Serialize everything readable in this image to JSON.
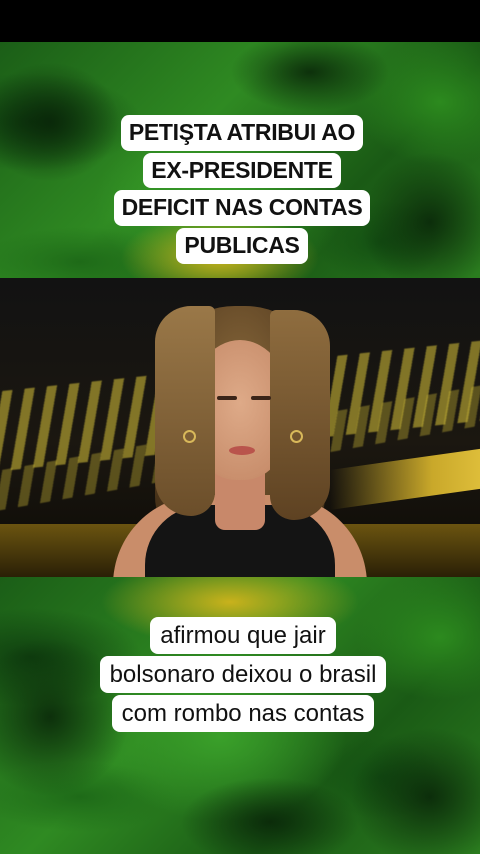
{
  "overlay_top": {
    "lines": [
      "PETIŞTA ATRIBUI AO",
      "EX-PRESIDENTE",
      "DEFICIT NAS CONTAS",
      "PUBLICAS"
    ]
  },
  "overlay_bottom": {
    "lines": [
      "afirmou que jair",
      "bolsonaro deixou o brasil",
      "com rombo nas contas"
    ]
  },
  "colors": {
    "background_green": "#2f8a22",
    "accent_yellow": "#c9b21c",
    "caption_bg": "#ffffff",
    "caption_text": "#111111"
  }
}
